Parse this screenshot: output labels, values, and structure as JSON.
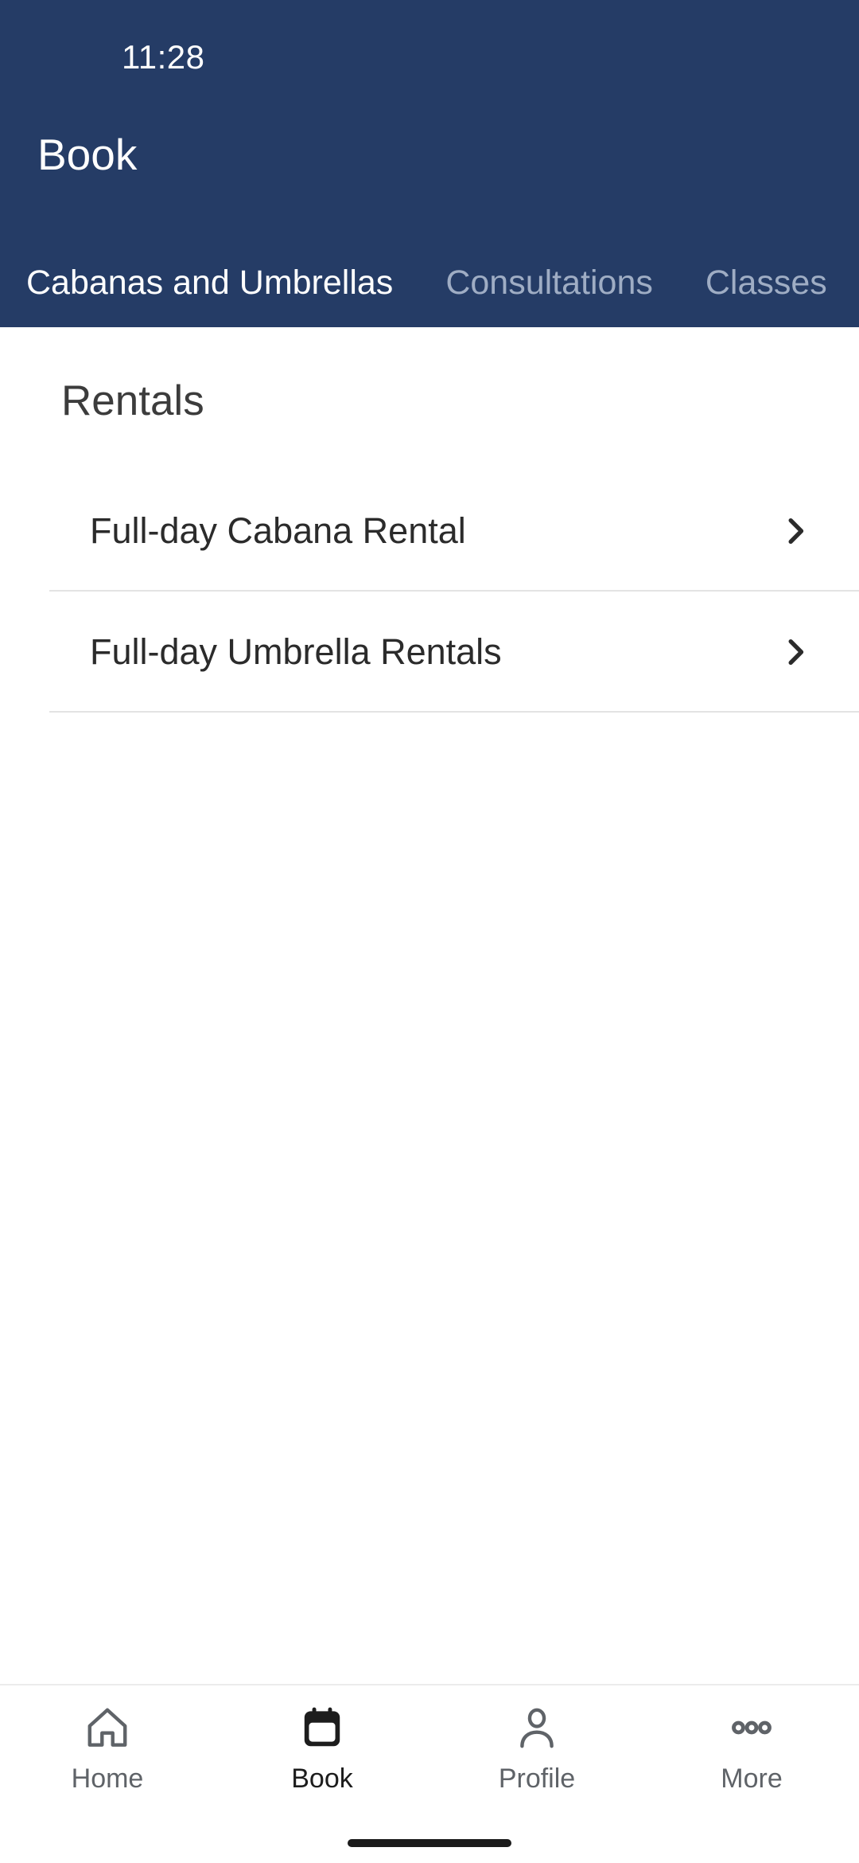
{
  "status_bar": {
    "time": "11:28"
  },
  "header": {
    "title": "Book",
    "background_color": "#253c66",
    "text_color": "#ffffff"
  },
  "tabs": {
    "items": [
      {
        "label": "Cabanas and Umbrellas",
        "active": true
      },
      {
        "label": "Consultations",
        "active": false
      },
      {
        "label": "Classes",
        "active": false
      }
    ]
  },
  "main": {
    "section_title": "Rentals",
    "items": [
      {
        "label": "Full-day Cabana Rental",
        "chevron": "chevron-right-icon"
      },
      {
        "label": "Full-day Umbrella Rentals",
        "chevron": "chevron-right-icon"
      }
    ]
  },
  "bottom_nav": {
    "items": [
      {
        "label": "Home",
        "icon": "home-icon",
        "active": false
      },
      {
        "label": "Book",
        "icon": "calendar-icon",
        "active": true
      },
      {
        "label": "Profile",
        "icon": "person-icon",
        "active": false
      },
      {
        "label": "More",
        "icon": "more-horizontal-icon",
        "active": false
      }
    ]
  }
}
